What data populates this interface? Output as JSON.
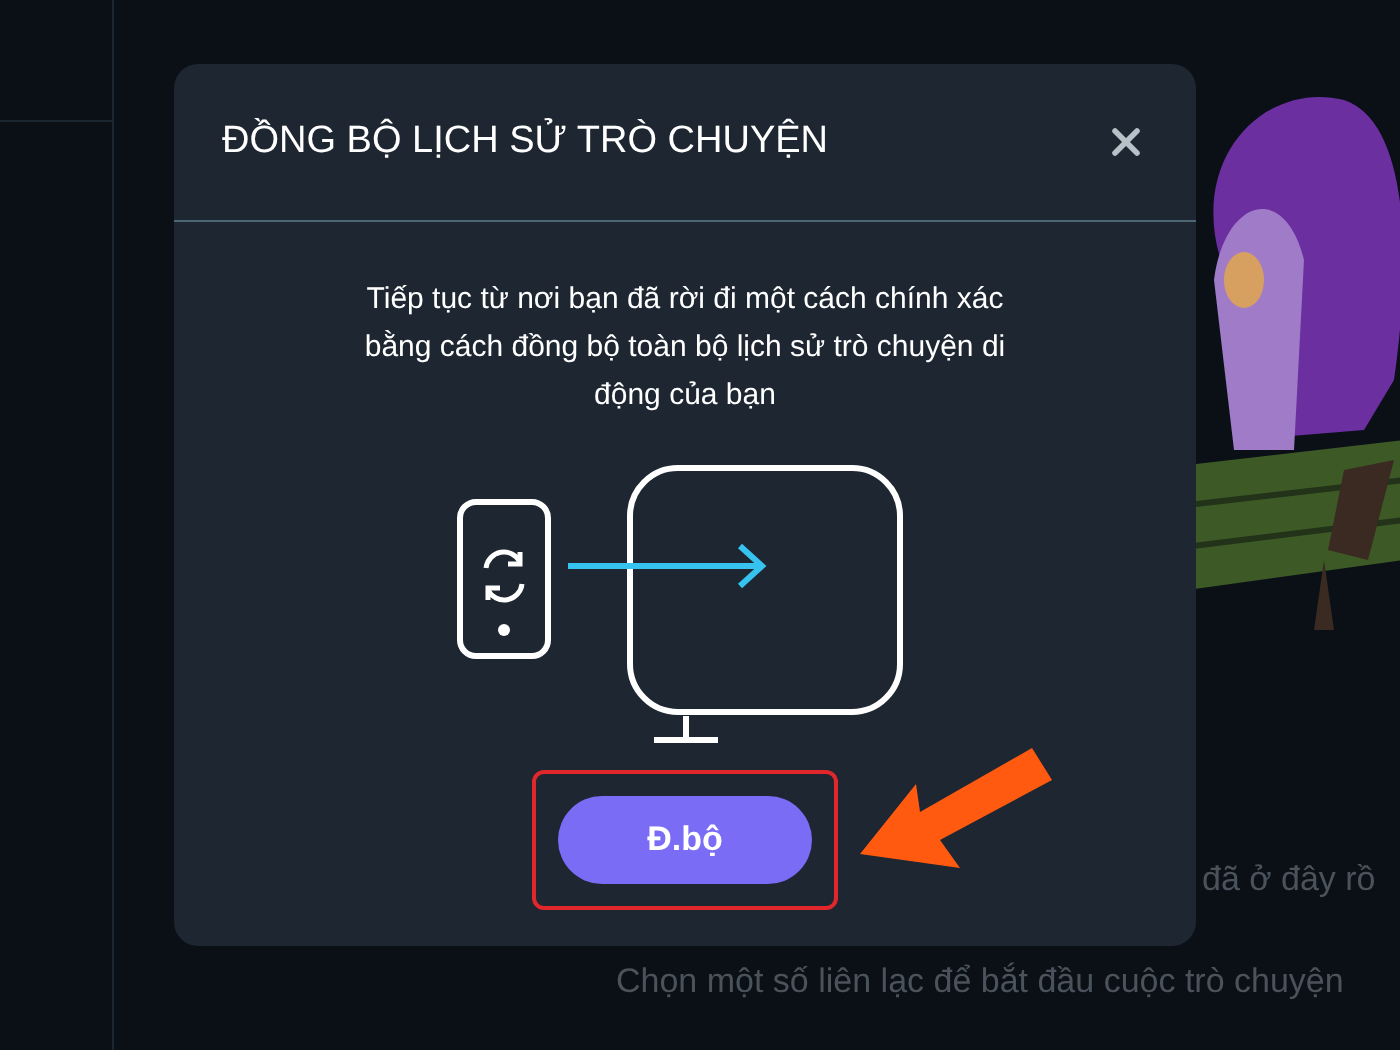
{
  "background": {
    "greeting": "đã ở đây rồ",
    "hint": "Chọn một số liên lạc để bắt đầu cuộc trò chuyện"
  },
  "dialog": {
    "title": "ĐỒNG BỘ LỊCH SỬ TRÒ CHUYỆN",
    "description": "Tiếp tục từ nơi bạn đã rời đi một cách chính xác bằng cách đồng bộ toàn bộ lịch sử trò chuyện di động của bạn",
    "button": "Đ.bộ"
  }
}
